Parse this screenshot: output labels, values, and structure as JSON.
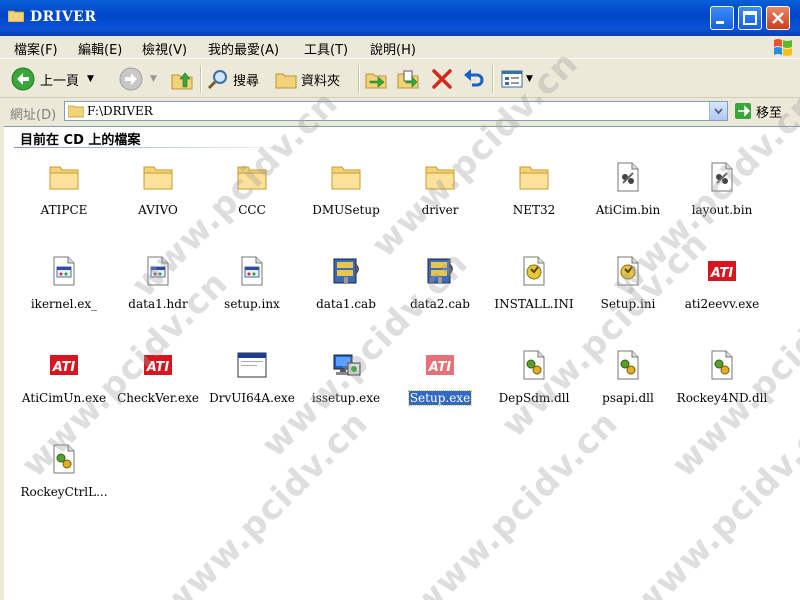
{
  "window": {
    "title": "DRIVER"
  },
  "menu": [
    "檔案(F)",
    "編輯(E)",
    "檢視(V)",
    "我的最愛(A)",
    "工具(T)",
    "說明(H)"
  ],
  "toolbar": {
    "back_label": "上一頁",
    "search_label": "搜尋",
    "folders_label": "資料夾"
  },
  "address": {
    "label": "網址(D)",
    "value": "F:\\DRIVER",
    "go_label": "移至"
  },
  "content": {
    "group_header": "目前在 CD 上的檔案"
  },
  "files": [
    {
      "name": "ATIPCE",
      "icon": "folder-icon"
    },
    {
      "name": "AVIVO",
      "icon": "folder-icon"
    },
    {
      "name": "CCC",
      "icon": "folder-icon"
    },
    {
      "name": "DMUSetup",
      "icon": "folder-icon"
    },
    {
      "name": "driver",
      "icon": "folder-icon"
    },
    {
      "name": "NET32",
      "icon": "folder-icon"
    },
    {
      "name": "AtiCim.bin",
      "icon": "bin-file-icon"
    },
    {
      "name": "layout.bin",
      "icon": "bin-file-icon"
    },
    {
      "name": "ikernel.ex_",
      "icon": "setup-info-icon"
    },
    {
      "name": "data1.hdr",
      "icon": "setup-info-icon"
    },
    {
      "name": "setup.inx",
      "icon": "setup-info-icon"
    },
    {
      "name": "data1.cab",
      "icon": "cab-archive-icon"
    },
    {
      "name": "data2.cab",
      "icon": "cab-archive-icon"
    },
    {
      "name": "INSTALL.INI",
      "icon": "ini-file-icon"
    },
    {
      "name": "Setup.ini",
      "icon": "ini-file-icon"
    },
    {
      "name": "ati2eevv.exe",
      "icon": "ati-logo-icon"
    },
    {
      "name": "AtiCimUn.exe",
      "icon": "ati-logo-icon"
    },
    {
      "name": "CheckVer.exe",
      "icon": "ati-logo-icon"
    },
    {
      "name": "DrvUI64A.exe",
      "icon": "app-window-icon"
    },
    {
      "name": "issetup.exe",
      "icon": "installer-icon"
    },
    {
      "name": "Setup.exe",
      "icon": "ati-logo-icon",
      "selected": true
    },
    {
      "name": "DepSdm.dll",
      "icon": "dll-file-icon"
    },
    {
      "name": "psapi.dll",
      "icon": "dll-file-icon"
    },
    {
      "name": "Rockey4ND.dll",
      "icon": "dll-file-icon"
    },
    {
      "name": "RockeyCtrlL...",
      "icon": "dll-file-icon"
    }
  ],
  "watermark": "www.pcidv.cn"
}
